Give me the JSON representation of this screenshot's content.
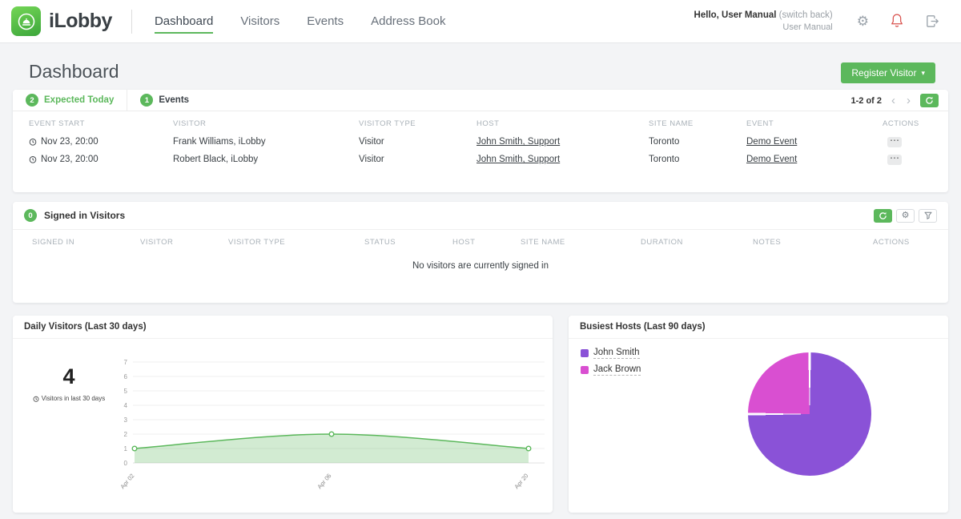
{
  "theme": {
    "accent_green": "#5cb85c",
    "alert_red": "#d9534f",
    "pie_purple": "#8a52d7",
    "pie_magenta": "#d94fd1"
  },
  "header": {
    "brand": "iLobby",
    "nav": [
      {
        "label": "Dashboard"
      },
      {
        "label": "Visitors"
      },
      {
        "label": "Events"
      },
      {
        "label": "Address Book"
      }
    ],
    "greeting_bold": "Hello, User Manual",
    "greeting_link": "(switch back)",
    "greeting_sub": "User Manual"
  },
  "page": {
    "title": "Dashboard",
    "register_button": "Register Visitor"
  },
  "expected_panel": {
    "tabs": [
      {
        "badge": "2",
        "label": "Expected Today"
      },
      {
        "badge": "1",
        "label": "Events"
      }
    ],
    "pagination": "1-2 of 2",
    "headers": [
      "EVENT START",
      "VISITOR",
      "VISITOR TYPE",
      "HOST",
      "SITE NAME",
      "EVENT",
      "ACTIONS"
    ],
    "rows": [
      {
        "event_start": "Nov 23, 20:00",
        "visitor": "Frank Williams, iLobby",
        "visitor_type": "Visitor",
        "host": "John Smith, Support",
        "site_name": "Toronto",
        "event": "Demo Event"
      },
      {
        "event_start": "Nov 23, 20:00",
        "visitor": "Robert Black, iLobby",
        "visitor_type": "Visitor",
        "host": "John Smith, Support",
        "site_name": "Toronto",
        "event": "Demo Event"
      }
    ]
  },
  "signed_in_panel": {
    "badge": "0",
    "title": "Signed in Visitors",
    "headers": [
      "SIGNED IN",
      "VISITOR",
      "VISITOR TYPE",
      "STATUS",
      "HOST",
      "SITE NAME",
      "DURATION",
      "NOTES",
      "ACTIONS"
    ],
    "empty_message": "No visitors are currently signed in"
  },
  "daily_panel": {
    "title": "Daily Visitors (Last 30 days)",
    "total": "4",
    "total_caption": "Visitors in last 30 days"
  },
  "hosts_panel": {
    "title": "Busiest Hosts (Last 90 days)"
  },
  "icons": {
    "caret_down": "▾",
    "chevron_left": "‹",
    "chevron_right": "›",
    "ellipsis": "⋯",
    "gear": "⚙"
  },
  "chart_data": [
    {
      "type": "area",
      "title": "Daily Visitors (Last 30 days)",
      "x": [
        "Apr 02",
        "Apr 06",
        "Apr 20"
      ],
      "values": [
        1,
        2,
        1
      ],
      "ylim": [
        0,
        7
      ],
      "yticks": [
        0,
        1,
        2,
        3,
        4,
        5,
        6,
        7
      ],
      "color": "#5cb85c",
      "fill_opacity": 0.28,
      "grid": true,
      "total_visitors": 4
    },
    {
      "type": "pie",
      "title": "Busiest Hosts (Last 90 days)",
      "labels": [
        "John Smith",
        "Jack Brown"
      ],
      "values": [
        75,
        25
      ],
      "colors": [
        "#8a52d7",
        "#d94fd1"
      ],
      "legend_position": "top-left"
    }
  ]
}
